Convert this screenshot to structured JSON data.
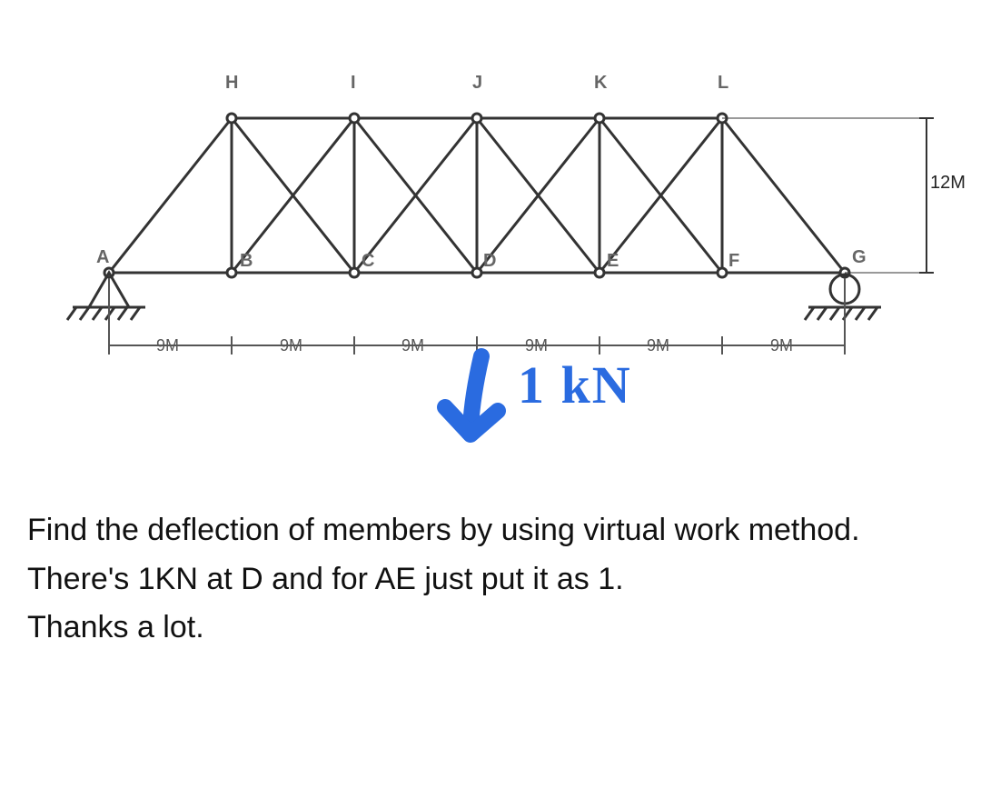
{
  "truss": {
    "nodes_top": {
      "H": "H",
      "I": "I",
      "J": "J",
      "K": "K",
      "L": "L"
    },
    "nodes_bottom": {
      "A": "A",
      "B": "B",
      "C": "C",
      "D": "D",
      "E": "E",
      "F": "F",
      "G": "G"
    },
    "span_labels": [
      "9M",
      "9M",
      "9M",
      "9M",
      "9M",
      "9M"
    ],
    "height_label": "12M",
    "load_annotation": "1 kN"
  },
  "problem_text": {
    "line1": "Find the deflection of members by using virtual work method.",
    "line2": "There's 1KN at D and for AE just put it as 1.",
    "line3": "Thanks a lot."
  }
}
